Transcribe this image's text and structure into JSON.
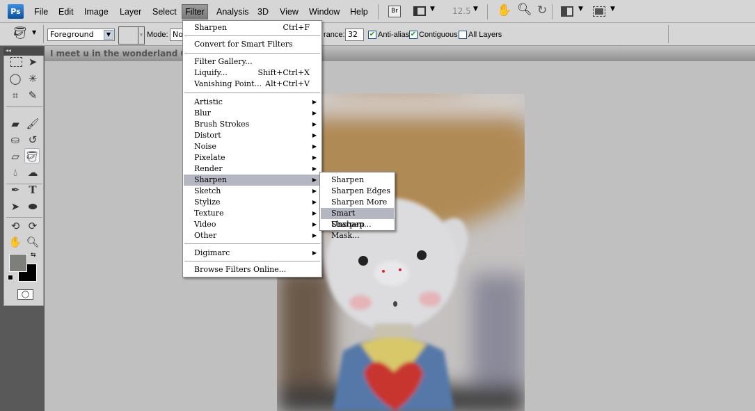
{
  "app": {
    "logo": "Ps"
  },
  "menubar": {
    "items": [
      "File",
      "Edit",
      "Image",
      "Layer",
      "Select",
      "Filter",
      "Analysis",
      "3D",
      "View",
      "Window",
      "Help"
    ],
    "active": "Filter",
    "bridge": "Br",
    "zoom": "12.5"
  },
  "options": {
    "fill_source": "Foreground",
    "mode_label": "Mode:",
    "mode_value": "No",
    "tolerance_label": "rance:",
    "tolerance_value": "32",
    "anti_alias": "Anti-alias",
    "anti_alias_checked": true,
    "contiguous": "Contiguous",
    "contiguous_checked": true,
    "all_layers": "All Layers",
    "all_layers_checked": false
  },
  "document": {
    "title": "I meet u in the wonderland 001.jpg"
  },
  "colors": {
    "foreground": "#7d7f7a",
    "background": "#000000",
    "highlight": "#b4b6c2"
  },
  "filter_menu": {
    "last_filter": {
      "label": "Sharpen",
      "shortcut": "Ctrl+F"
    },
    "convert": "Convert for Smart Filters",
    "gallery": [
      {
        "label": "Filter Gallery...",
        "shortcut": ""
      },
      {
        "label": "Liquify...",
        "shortcut": "Shift+Ctrl+X"
      },
      {
        "label": "Vanishing Point...",
        "shortcut": "Alt+Ctrl+V"
      }
    ],
    "groups": [
      "Artistic",
      "Blur",
      "Brush Strokes",
      "Distort",
      "Noise",
      "Pixelate",
      "Render",
      "Sharpen",
      "Sketch",
      "Stylize",
      "Texture",
      "Video",
      "Other"
    ],
    "highlighted": "Sharpen",
    "digimarc": "Digimarc",
    "browse": "Browse Filters Online..."
  },
  "sharpen_submenu": {
    "items": [
      "Sharpen",
      "Sharpen Edges",
      "Sharpen More",
      "Smart Sharpen...",
      "Unsharp Mask..."
    ],
    "highlighted": "Smart Sharpen..."
  }
}
